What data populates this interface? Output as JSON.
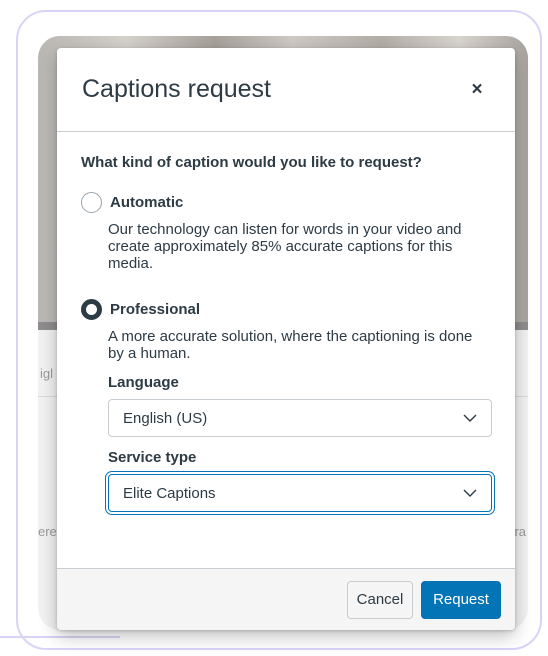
{
  "modal": {
    "title": "Captions request",
    "close_label": "×",
    "question": "What kind of caption would you like to request?",
    "options": [
      {
        "label": "Automatic",
        "description": "Our technology can listen for words in your video and create approximately 85% accurate captions for this media.",
        "selected": false
      },
      {
        "label": "Professional",
        "description": "A more accurate solution, where the captioning is done by a human.",
        "selected": true
      }
    ],
    "language": {
      "label": "Language",
      "value": "English (US)"
    },
    "service_type": {
      "label": "Service type",
      "value": "Elite Captions"
    },
    "footer": {
      "cancel_label": "Cancel",
      "request_label": "Request"
    }
  },
  "background": {
    "left_text_1": "igl",
    "left_text_2": "ere",
    "right_text": "ra"
  },
  "colors": {
    "primary": "#0374b5",
    "text": "#2d3b45",
    "frame": "#d9d3f5"
  }
}
